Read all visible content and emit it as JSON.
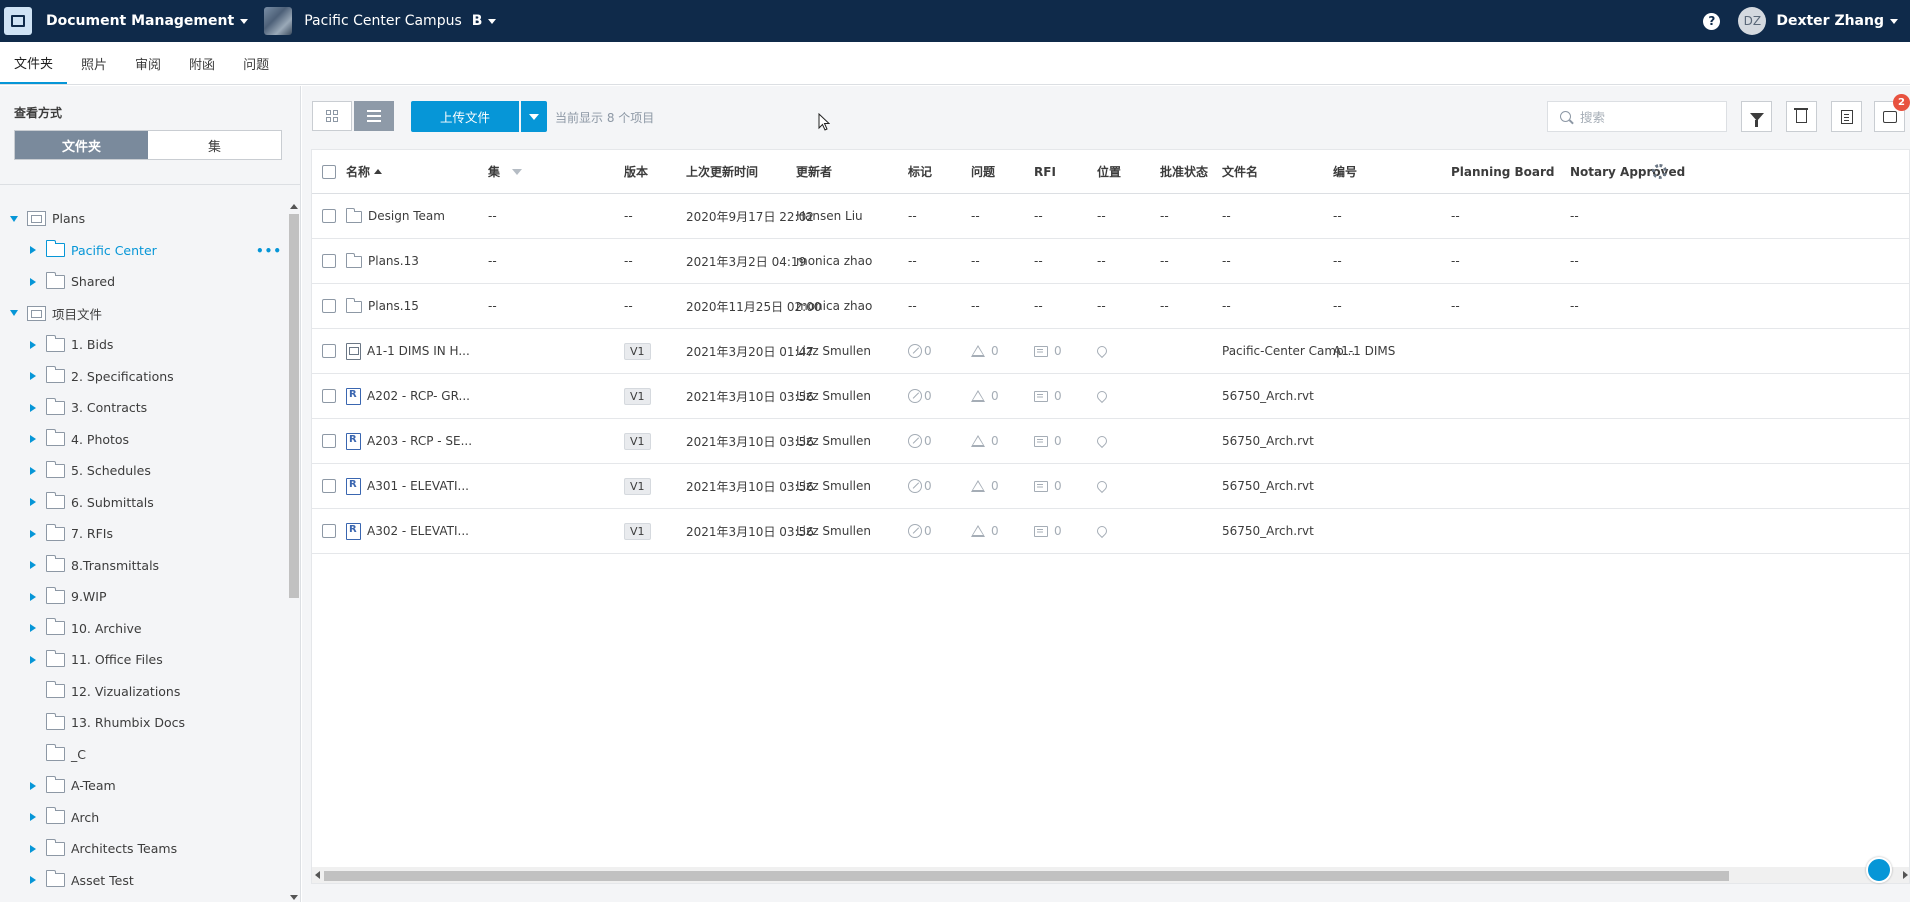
{
  "topbar": {
    "app_name": "Document Management",
    "project_name": "Pacific Center Campus",
    "project_badge": "B",
    "help_icon": "?",
    "user_initials": "DZ",
    "user_name": "Dexter Zhang"
  },
  "tabs": [
    {
      "label": "文件夹",
      "active": true
    },
    {
      "label": "照片"
    },
    {
      "label": "审阅"
    },
    {
      "label": "附函"
    },
    {
      "label": "问题"
    }
  ],
  "sidebar": {
    "view_label": "查看方式",
    "seg_folders": "文件夹",
    "seg_sets": "集",
    "tree": [
      {
        "label": "Plans",
        "level": 0,
        "expanded": true,
        "icon": "root-folder-icon"
      },
      {
        "label": "Pacific Center",
        "level": 1,
        "selected": true,
        "has_children": true
      },
      {
        "label": "Shared",
        "level": 1,
        "has_children": true
      },
      {
        "label": "项目文件",
        "level": 0,
        "expanded": true,
        "icon": "root-folder-icon"
      },
      {
        "label": "1. Bids",
        "level": 1,
        "has_children": true
      },
      {
        "label": "2. Specifications",
        "level": 1,
        "has_children": true
      },
      {
        "label": "3. Contracts",
        "level": 1,
        "has_children": true
      },
      {
        "label": "4. Photos",
        "level": 1,
        "has_children": true
      },
      {
        "label": "5. Schedules",
        "level": 1,
        "has_children": true
      },
      {
        "label": "6. Submittals",
        "level": 1,
        "has_children": true
      },
      {
        "label": "7. RFIs",
        "level": 1,
        "has_children": true
      },
      {
        "label": "8.Transmittals",
        "level": 1,
        "has_children": true
      },
      {
        "label": "9.WIP",
        "level": 1,
        "has_children": true
      },
      {
        "label": "10. Archive",
        "level": 1,
        "has_children": true
      },
      {
        "label": "11. Office Files",
        "level": 1,
        "has_children": true
      },
      {
        "label": "12. Vizualizations",
        "level": 1,
        "has_children": false
      },
      {
        "label": "13. Rhumbix Docs",
        "level": 1,
        "has_children": false
      },
      {
        "label": "_C",
        "level": 1,
        "has_children": false
      },
      {
        "label": "A-Team",
        "level": 1,
        "has_children": true
      },
      {
        "label": "Arch",
        "level": 1,
        "has_children": true
      },
      {
        "label": "Architects Teams",
        "level": 1,
        "has_children": true
      },
      {
        "label": "Asset Test",
        "level": 1,
        "has_children": true
      }
    ],
    "more_label": "•••"
  },
  "toolbar": {
    "upload_label": "上传文件",
    "count_text": "当前显示 8 个项目",
    "search_placeholder": "搜索",
    "notification_count": "2"
  },
  "table": {
    "columns": [
      "名称",
      "集",
      "版本",
      "上次更新时间",
      "更新者",
      "标记",
      "问题",
      "RFI",
      "位置",
      "批准状态",
      "文件名",
      "编号",
      "Planning Board",
      "Notary Approved"
    ],
    "rows": [
      {
        "type": "folder",
        "name": "Design Team",
        "set": "--",
        "version": "--",
        "updated": "2020年9月17日 22:02",
        "by": "Hansen Liu",
        "markup": "--",
        "issues": "--",
        "rfi": "--",
        "location": "--",
        "approval": "--",
        "filename": "--",
        "number": "--",
        "planning": "--",
        "notary": "--"
      },
      {
        "type": "folder",
        "name": "Plans.13",
        "set": "--",
        "version": "--",
        "updated": "2021年3月2日 04:19",
        "by": "monica zhao",
        "markup": "--",
        "issues": "--",
        "rfi": "--",
        "location": "--",
        "approval": "--",
        "filename": "--",
        "number": "--",
        "planning": "--",
        "notary": "--"
      },
      {
        "type": "folder",
        "name": "Plans.15",
        "set": "--",
        "version": "--",
        "updated": "2020年11月25日 02:00",
        "by": "monica zhao",
        "markup": "--",
        "issues": "--",
        "rfi": "--",
        "location": "--",
        "approval": "--",
        "filename": "--",
        "number": "--",
        "planning": "--",
        "notary": "--"
      },
      {
        "type": "pdf",
        "name": "A1-1 DIMS IN H...",
        "set": "",
        "version": "V1",
        "updated": "2021年3月20日 01:47",
        "by": "Lizz Smullen",
        "markup": "0",
        "issues": "0",
        "rfi": "0",
        "location": "",
        "approval": "",
        "filename": "Pacific-Center Camp...",
        "number": "A1-1 DIMS",
        "planning": "",
        "notary": ""
      },
      {
        "type": "rvt",
        "name": "A202 - RCP- GR...",
        "set": "",
        "version": "V1",
        "updated": "2021年3月10日 03:56",
        "by": "Lizz Smullen",
        "markup": "0",
        "issues": "0",
        "rfi": "0",
        "location": "",
        "approval": "",
        "filename": "56750_Arch.rvt",
        "number": "",
        "planning": "",
        "notary": ""
      },
      {
        "type": "rvt",
        "name": "A203 - RCP - SE...",
        "set": "",
        "version": "V1",
        "updated": "2021年3月10日 03:56",
        "by": "Lizz Smullen",
        "markup": "0",
        "issues": "0",
        "rfi": "0",
        "location": "",
        "approval": "",
        "filename": "56750_Arch.rvt",
        "number": "",
        "planning": "",
        "notary": ""
      },
      {
        "type": "rvt",
        "name": "A301 - ELEVATI...",
        "set": "",
        "version": "V1",
        "updated": "2021年3月10日 03:56",
        "by": "Lizz Smullen",
        "markup": "0",
        "issues": "0",
        "rfi": "0",
        "location": "",
        "approval": "",
        "filename": "56750_Arch.rvt",
        "number": "",
        "planning": "",
        "notary": ""
      },
      {
        "type": "rvt",
        "name": "A302 - ELEVATI...",
        "set": "",
        "version": "V1",
        "updated": "2021年3月10日 03:56",
        "by": "Lizz Smullen",
        "markup": "0",
        "issues": "0",
        "rfi": "0",
        "location": "",
        "approval": "",
        "filename": "56750_Arch.rvt",
        "number": "",
        "planning": "",
        "notary": ""
      }
    ]
  },
  "colors": {
    "accent": "#0696d7",
    "topbar": "#0f2a4a",
    "badge": "#e8523f"
  }
}
